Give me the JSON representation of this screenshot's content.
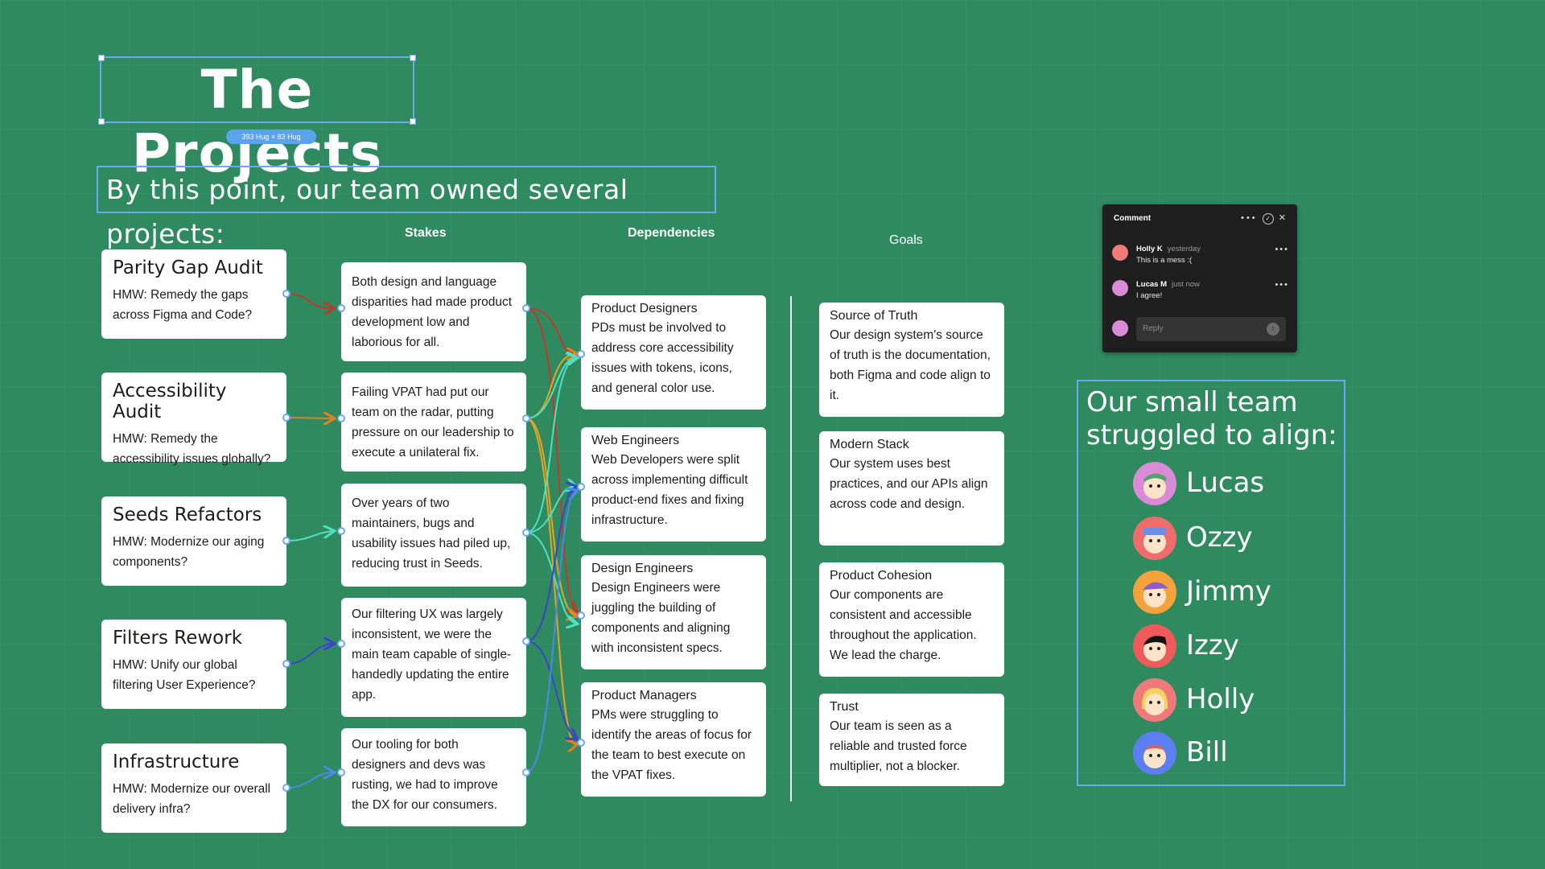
{
  "title": "The Projects",
  "size_badge": "393 Hug × 83 Hug",
  "subtitle": "By this point, our team owned several projects:",
  "columns": {
    "stakes": "Stakes",
    "dependencies": "Dependencies",
    "goals": "Goals"
  },
  "projects": [
    {
      "title": "Parity Gap Audit",
      "desc": "HMW: Remedy the gaps across Figma and Code?"
    },
    {
      "title": "Accessibility Audit",
      "desc": "HMW: Remedy the accessibility issues globally?"
    },
    {
      "title": "Seeds Refactors",
      "desc": "HMW: Modernize our aging components?"
    },
    {
      "title": "Filters Rework",
      "desc": "HMW: Unify our global filtering User Experience?"
    },
    {
      "title": "Infrastructure",
      "desc": "HMW: Modernize our overall delivery infra?"
    }
  ],
  "stakes": [
    "Both design and language disparities had made product development low and laborious for all.",
    "Failing VPAT had put our team on the radar, putting pressure on our leadership to execute a unilateral fix.",
    "Over years of two maintainers, bugs and usability issues had piled up, reducing trust in Seeds.",
    "Our filtering UX was largely inconsistent, we were the main team capable of single-handedly updating the entire app.",
    "Our tooling for both designers and devs was rusting, we had to improve the DX for our consumers."
  ],
  "dependencies": [
    {
      "title": "Product Designers",
      "desc": "PDs must be involved to address core accessibility issues with tokens, icons, and general color use."
    },
    {
      "title": "Web Engineers",
      "desc": "Web Developers were split across implementing difficult product-end fixes and fixing infrastructure."
    },
    {
      "title": "Design Engineers",
      "desc": "Design Engineers were juggling the building of components and aligning with inconsistent specs."
    },
    {
      "title": "Product Managers",
      "desc": "PMs were struggling to identify the areas of focus for the team to best execute on the VPAT fixes."
    }
  ],
  "goals": [
    {
      "title": "Source of Truth",
      "desc": "Our design system's source of truth is the documentation, both Figma and code align to it."
    },
    {
      "title": "Modern Stack",
      "desc": "Our system uses best practices, and our APIs align across code and design."
    },
    {
      "title": "Product Cohesion",
      "desc": "Our components are consistent and accessible throughout the application. We lead the charge."
    },
    {
      "title": "Trust",
      "desc": "Our team is seen as a reliable and trusted force multiplier, not a blocker."
    }
  ],
  "comment": {
    "header": "Comment",
    "items": [
      {
        "name": "Holly K",
        "time": "yesterday",
        "text": "This is a mess :("
      },
      {
        "name": "Lucas M",
        "time": "just now",
        "text": "I agree!"
      }
    ],
    "reply_placeholder": "Reply"
  },
  "team": {
    "title": "Our small team struggled to align:",
    "members": [
      {
        "name": "Lucas",
        "icon": "avatar-lucas-icon",
        "color": "#d98bd6"
      },
      {
        "name": "Ozzy",
        "icon": "avatar-ozzy-icon",
        "color": "#f06b6b"
      },
      {
        "name": "Jimmy",
        "icon": "avatar-jimmy-icon",
        "color": "#f6a23c"
      },
      {
        "name": "Izzy",
        "icon": "avatar-izzy-icon",
        "color": "#ef5a5a"
      },
      {
        "name": "Holly",
        "icon": "avatar-holly-icon",
        "color": "#f07a7a"
      },
      {
        "name": "Bill",
        "icon": "avatar-bill-icon",
        "color": "#5b7ff0"
      }
    ]
  },
  "colors": {
    "background": "#2f8a60",
    "selection": "#6aa8ef"
  }
}
